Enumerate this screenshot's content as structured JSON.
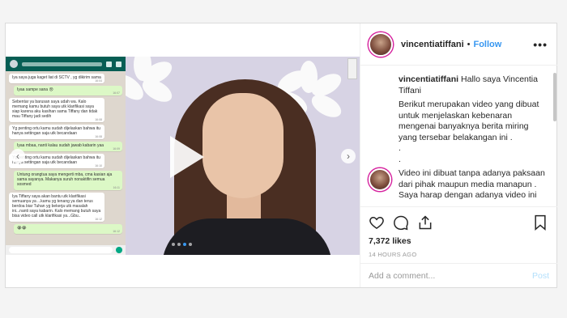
{
  "post": {
    "username": "vincentiatiffani",
    "separator": "•",
    "follow_label": "Follow",
    "more_label": "•••",
    "caption_username": "vincentiatiffani",
    "caption_first": "Hallo saya Vincentia Tiffani",
    "caption_lines": [
      "Berikut merupakan video yang dibuat untuk menjelaskan kebenaran mengenai banyaknya berita miring yang tersebar belakangan ini .",
      ".",
      ".",
      "Video ini dibuat tanpa adanya paksaan dari pihak maupun media manapun .",
      "Saya harap dengan adanya video ini"
    ],
    "likes": "7,372 likes",
    "timestamp": "14 HOURS AGO",
    "comment_placeholder": "Add a comment...",
    "post_button": "Post"
  },
  "chat": {
    "bubbles": [
      {
        "dir": "in",
        "text": "Iya saya juga kaget liat di SCTV , yg dikirim sama",
        "time": "16:04"
      },
      {
        "dir": "out",
        "text": "Iyaa sampe sana 😢",
        "time": "16:07"
      },
      {
        "dir": "in",
        "text": "Sebentar ya barusan saya udah wa. Kalo memang kamu butuh saya utk klarifikasi saya siap karena aku kasihan sama Tiffany dan tidak mau Tiffany jadi sedih",
        "time": "16:08"
      },
      {
        "dir": "in",
        "text": "Yg penting ortu kamu sudah dijelaskan bahwa itu hanya settingan saja utk becandaan",
        "time": "16:08"
      },
      {
        "dir": "out",
        "text": "Iyaa mbaa, nanti kalau sudah jawab kabarin yaa",
        "time": "16:09"
      },
      {
        "dir": "in",
        "text": "Yg penting ortu kamu sudah dijelaskan bahwa itu hanya settingan saja utk becandaan",
        "time": "16:10"
      },
      {
        "dir": "out",
        "text": "Untung orangtua saya mengerti mba, cma kasian aja sama sayanya. Makanya suruh nonaktifin semua sosmed",
        "time": "16:11"
      },
      {
        "dir": "in",
        "text": "Iya Tiffany saya akan bantu utk klarifikasi semuanya ya ...kamu yg tenang ya dan terus berdoa biar Tuhan yg bekerja utk masalah ini...nanti saya kabarin. Kalo memang butuh saya bisa video call utk klarifikasi ya...Gbu..",
        "time": "16:12"
      },
      {
        "dir": "out",
        "text": "😭😭",
        "time": "16:12"
      }
    ]
  },
  "media": {
    "slide_count": 4,
    "active_slide": 2
  },
  "colors": {
    "accent": "#3897f0",
    "whatsapp_header": "#075e54",
    "whatsapp_out": "#dcf8c6"
  }
}
